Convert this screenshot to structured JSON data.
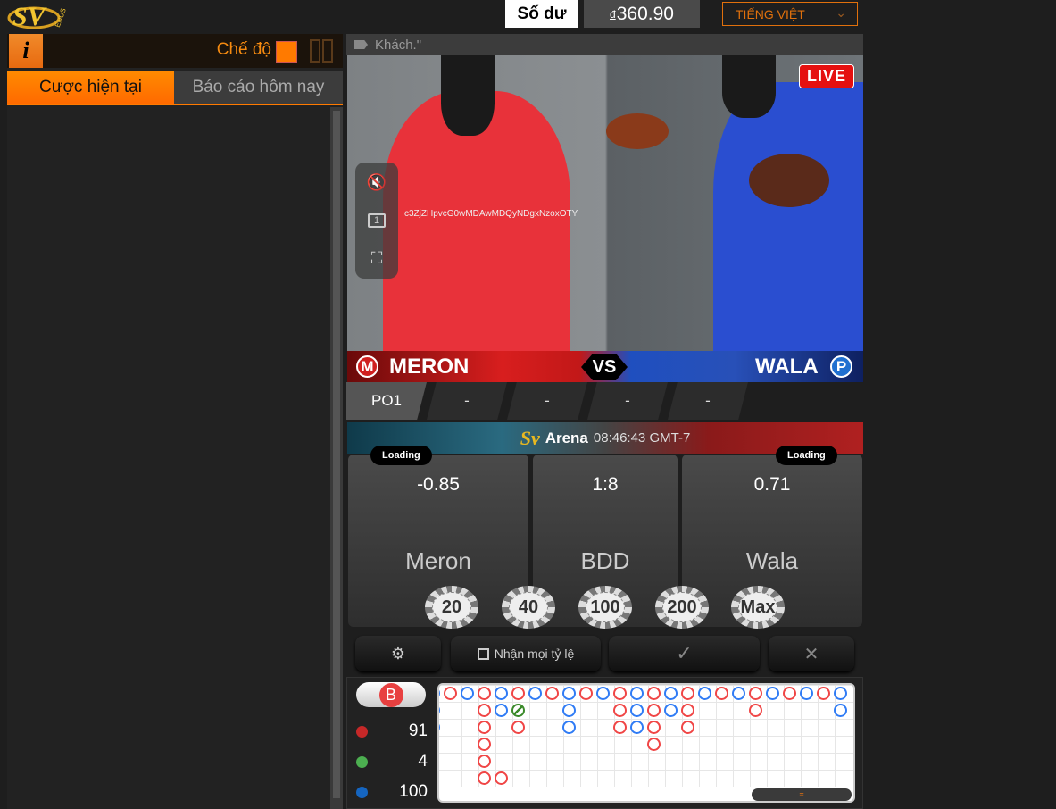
{
  "header": {
    "logo_text": "SV",
    "logo_sub": "ENUS",
    "balance_label": "Số dư",
    "currency": "đ",
    "balance": "360.90",
    "language": "TIẾNG VIỆT"
  },
  "left_panel": {
    "info_icon": "i",
    "mode_label": "Chế độ",
    "tabs": [
      {
        "label": "Cược hiện tại",
        "active": true
      },
      {
        "label": "Báo cáo hôm nay",
        "active": false
      }
    ]
  },
  "video": {
    "title": "Khách.\"",
    "live": "LIVE",
    "watermark": "c3ZjZHpvcG0wMDAwMDQyNDgxNzoxOTY",
    "controls": [
      "mute-icon",
      "screen-1-icon",
      "fullscreen-icon"
    ],
    "screen_num": "1"
  },
  "matchup": {
    "left_badge": "M",
    "left": "MERON",
    "vs": "VS",
    "right": "WALA",
    "right_badge": "P"
  },
  "rounds": [
    "PO1",
    "-",
    "-",
    "-",
    "-"
  ],
  "arena": {
    "logo": "Sv",
    "name": "Arena",
    "time": "08:46:43 GMT-7",
    "left_status": "Loading",
    "right_status": "Loading"
  },
  "bets": [
    {
      "odds": "-0.85",
      "name": "Meron"
    },
    {
      "odds": "1:8",
      "name": "BDD"
    },
    {
      "odds": "0.71",
      "name": "Wala"
    }
  ],
  "chips": [
    "20",
    "40",
    "100",
    "200",
    "Max"
  ],
  "actions": {
    "accept_all_label": "Nhận mọi tỷ lệ",
    "accept_all_checked": false
  },
  "stats": {
    "b_label": "B",
    "red": "91",
    "green": "4",
    "blue": "100",
    "colors": {
      "red": "#c62828",
      "green": "#4caf50",
      "blue": "#1565c0"
    }
  },
  "road": {
    "legend": {
      "R": "#f04545",
      "B": "#2f7bf5",
      "G": "#3a8a2a"
    },
    "columns": [
      [
        "B",
        "B",
        "B"
      ],
      [
        "R"
      ],
      [
        "B"
      ],
      [
        "R",
        "R",
        "R",
        "R",
        "R",
        "R"
      ],
      [
        "B",
        "B",
        "",
        "",
        "",
        "R"
      ],
      [
        "R",
        "G",
        "R"
      ],
      [
        "B"
      ],
      [
        "R"
      ],
      [
        "B",
        "B",
        "B"
      ],
      [
        "R"
      ],
      [
        "B"
      ],
      [
        "R",
        "R",
        "R"
      ],
      [
        "B",
        "B",
        "B"
      ],
      [
        "R",
        "R",
        "R",
        "R"
      ],
      [
        "B",
        "B"
      ],
      [
        "R",
        "R",
        "R"
      ],
      [
        "B"
      ],
      [
        "R"
      ],
      [
        "B"
      ],
      [
        "R",
        "R"
      ],
      [
        "B"
      ],
      [
        "R"
      ],
      [
        "B"
      ],
      [
        "R"
      ],
      [
        "B",
        "B"
      ]
    ]
  },
  "colors": {
    "accent": "#ff7a00"
  }
}
